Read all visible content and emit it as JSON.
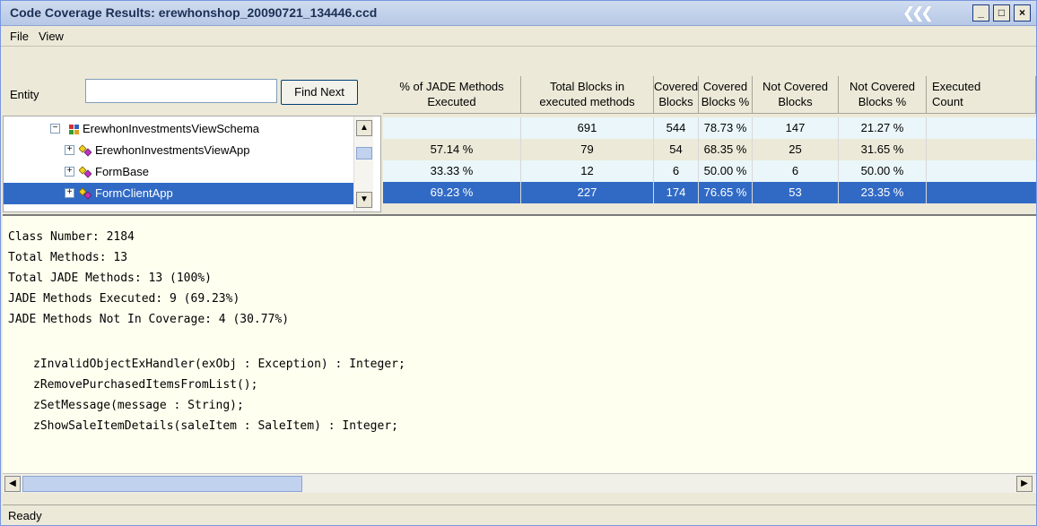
{
  "window": {
    "title": "Code Coverage Results: erewhonshop_20090721_134446.ccd",
    "controls": {
      "minimize": "_",
      "maximize": "□",
      "close": "×"
    },
    "chevrons": "❮❮❮"
  },
  "menu": {
    "file": "File",
    "view": "View"
  },
  "search": {
    "label": "Entity",
    "value": "",
    "button": "Find Next"
  },
  "columns": [
    "% of JADE Methods Executed",
    "Total Blocks in executed methods",
    "Covered Blocks",
    "Covered Blocks %",
    "Not Covered Blocks",
    "Not Covered Blocks %",
    "Executed Count"
  ],
  "column_lines": [
    [
      "% of JADE Methods",
      "Executed"
    ],
    [
      "Total Blocks in",
      "executed methods"
    ],
    [
      "Covered",
      "Blocks"
    ],
    [
      "Covered",
      "Blocks %"
    ],
    [
      "Not Covered",
      "Blocks"
    ],
    [
      "Not Covered",
      "Blocks %"
    ],
    [
      "Executed",
      "Count"
    ]
  ],
  "tree": [
    {
      "label": "ErewhonInvestmentsViewSchema",
      "expander": "−",
      "icon": "schema-icon",
      "values": [
        "",
        "691",
        "544",
        "78.73 %",
        "147",
        "21.27 %",
        ""
      ]
    },
    {
      "label": "ErewhonInvestmentsViewApp",
      "expander": "+",
      "icon": "class-icon",
      "values": [
        "57.14 %",
        "79",
        "54",
        "68.35 %",
        "25",
        "31.65 %",
        ""
      ]
    },
    {
      "label": "FormBase",
      "expander": "+",
      "icon": "class-icon",
      "values": [
        "33.33 %",
        "12",
        "6",
        "50.00 %",
        "6",
        "50.00 %",
        ""
      ]
    },
    {
      "label": "FormClientApp",
      "expander": "+",
      "icon": "class-icon",
      "selected": true,
      "values": [
        "69.23 %",
        "227",
        "174",
        "76.65 %",
        "53",
        "23.35 %",
        ""
      ]
    }
  ],
  "details": {
    "lines": [
      "Class Number: 2184",
      "Total Methods: 13",
      "Total JADE Methods: 13 (100%)",
      "JADE Methods Executed: 9 (69.23%)",
      "JADE Methods Not In Coverage: 4 (30.77%)"
    ],
    "methods": [
      "zInvalidObjectExHandler(exObj : Exception) : Integer;",
      "zRemovePurchasedItemsFromList();",
      "zSetMessage(message : String);",
      "zShowSaleItemDetails(saleItem : SaleItem) : Integer;"
    ]
  },
  "status": "Ready",
  "colors": {
    "selection": "#316ac5",
    "detail_bg": "#fffff0",
    "alt_row": "#eaf6f9"
  }
}
